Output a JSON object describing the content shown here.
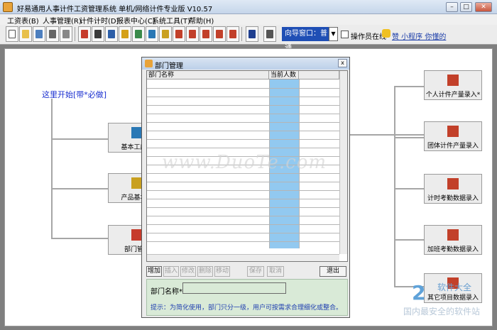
{
  "window": {
    "title": "好易通用人事计件工资管理系统 单机/网络计件专业版 V10.57"
  },
  "menu": [
    "工资表(B)",
    "人事管理(R)",
    "计件计时(D)",
    "报表中心(C)",
    "系统工具(T)",
    "帮助(H)"
  ],
  "toolbar": {
    "guide_label": "向导窗口：普通",
    "operator_online": "操作员在线",
    "link_text": "赞 小程序 你懂的"
  },
  "workflow": {
    "start_label": "这里开始[带*必做]",
    "left_nodes": [
      "基本工序设",
      "产品基本属",
      "部门管理"
    ],
    "right_nodes": [
      "个人计件产量录入*",
      "团体计件产量录入",
      "计时考勤数据录入",
      "加班考勤数据录入",
      "其它项目数据录入"
    ]
  },
  "dialog": {
    "title": "部门管理",
    "close": "x",
    "columns": [
      "部门名称",
      "当前人数"
    ],
    "buttons": [
      "增加",
      "插入",
      "修改",
      "删除",
      "移动",
      "保存",
      "取消",
      "退出"
    ],
    "field_label": "部门名称*:",
    "field_value": "",
    "hint": "提示：为简化使用，部门只分一级，用户可按需求合理细化或整合。"
  },
  "watermark": "www.DuoTe.com",
  "logo": {
    "glyph": "2",
    "line1": "软件大全",
    "line2": "国内最安全的软件站"
  },
  "colors": {
    "guide_bg": "#1f4fb5",
    "grid_highlight": "#92c9f0",
    "form_bg": "#d9ead7",
    "start_text": "#1a2fd0"
  }
}
